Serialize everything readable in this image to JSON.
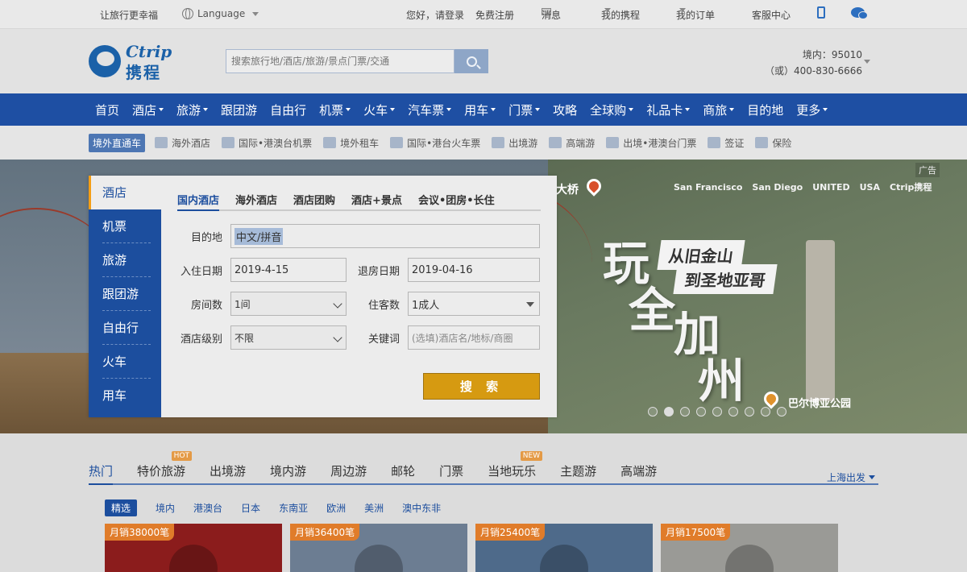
{
  "topbar": {
    "slogan": "让旅行更幸福",
    "language": "Language",
    "hello": "您好，请登录",
    "register": "免费注册",
    "messages": "消息",
    "my_trips": "我的携程",
    "my_orders": "我的订单",
    "service": "客服中心"
  },
  "header": {
    "logo_en": "Ctrip",
    "logo_cn": "携程",
    "search_placeholder": "搜索旅行地/酒店/旅游/景点门票/交通",
    "hotline1": "境内：95010",
    "hotline2": "（或）400-830-6666"
  },
  "mainnav": [
    {
      "label": "首页",
      "dropdown": false
    },
    {
      "label": "酒店",
      "dropdown": true
    },
    {
      "label": "旅游",
      "dropdown": true
    },
    {
      "label": "跟团游",
      "dropdown": false
    },
    {
      "label": "自由行",
      "dropdown": false
    },
    {
      "label": "机票",
      "dropdown": true
    },
    {
      "label": "火车",
      "dropdown": true
    },
    {
      "label": "汽车票",
      "dropdown": true
    },
    {
      "label": "用车",
      "dropdown": true
    },
    {
      "label": "门票",
      "dropdown": true
    },
    {
      "label": "攻略",
      "dropdown": false
    },
    {
      "label": "全球购",
      "dropdown": true
    },
    {
      "label": "礼品卡",
      "dropdown": true
    },
    {
      "label": "商旅",
      "dropdown": true
    },
    {
      "label": "目的地",
      "dropdown": false
    },
    {
      "label": "更多",
      "dropdown": true
    }
  ],
  "subnav": {
    "tag": "境外直通车",
    "items": [
      "海外酒店",
      "国际•港澳台机票",
      "境外租车",
      "国际•港台火车票",
      "出境游",
      "高端游",
      "出境•港澳台门票",
      "签证",
      "保险"
    ]
  },
  "banner": {
    "ad": "广告",
    "bridge_label": "大桥",
    "partners": [
      "San Francisco",
      "San Diego",
      "UNITED",
      "USA",
      "Ctrip携程"
    ],
    "big_chars": [
      "玩",
      "全",
      "加",
      "州"
    ],
    "tagline1": "从旧金山",
    "tagline2": "到圣地亚哥",
    "park": "巴尔博亚公园",
    "slides": 9,
    "active_slide": 2
  },
  "booking": {
    "side": [
      "酒店",
      "机票",
      "旅游",
      "跟团游",
      "自由行",
      "火车",
      "用车"
    ],
    "tabs": [
      "国内酒店",
      "海外酒店",
      "酒店团购",
      "酒店+景点",
      "会议•团房•长住"
    ],
    "labels": {
      "dest": "目的地",
      "checkin": "入住日期",
      "checkout": "退房日期",
      "rooms": "房间数",
      "guests": "住客数",
      "level": "酒店级别",
      "keyword": "关键词"
    },
    "values": {
      "dest": "中文/拼音",
      "checkin": "2019-4-15",
      "checkout": "2019-04-16",
      "rooms": "1间",
      "guests": "1成人",
      "level": "不限",
      "keyword_placeholder": "(选填)酒店名/地标/商圈"
    },
    "search_label": "搜 索"
  },
  "products": {
    "tabs": [
      {
        "label": "热门",
        "badge": ""
      },
      {
        "label": "特价旅游",
        "badge": "HOT"
      },
      {
        "label": "出境游",
        "badge": ""
      },
      {
        "label": "境内游",
        "badge": ""
      },
      {
        "label": "周边游",
        "badge": ""
      },
      {
        "label": "邮轮",
        "badge": ""
      },
      {
        "label": "门票",
        "badge": ""
      },
      {
        "label": "当地玩乐",
        "badge": "NEW"
      },
      {
        "label": "主题游",
        "badge": ""
      },
      {
        "label": "高端游",
        "badge": ""
      }
    ],
    "departure": "上海出发",
    "filters": [
      "精选",
      "境内",
      "港澳台",
      "日本",
      "东南亚",
      "欧洲",
      "美洲",
      "澳中东非"
    ],
    "cards": [
      {
        "sales": "月销38000笔",
        "color": "#8b1c1c"
      },
      {
        "sales": "月销36400笔",
        "color": "#6c7d92"
      },
      {
        "sales": "月销25400笔",
        "color": "#4e6a8a"
      },
      {
        "sales": "月销17500笔",
        "color": "#9a9a96"
      }
    ]
  }
}
